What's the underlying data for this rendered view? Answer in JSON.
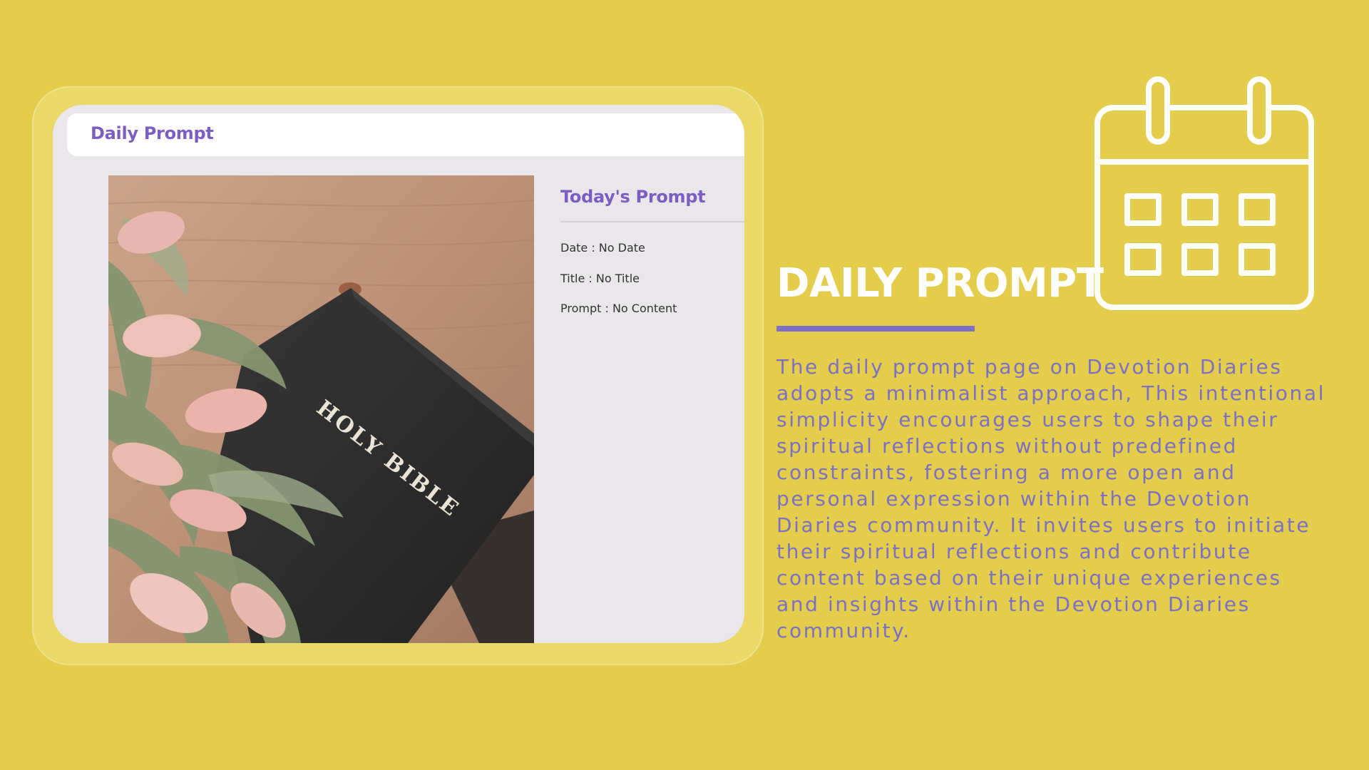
{
  "mockup": {
    "header_title": "Daily Prompt",
    "panel": {
      "title": "Today's Prompt",
      "date_line": "Date : No Date",
      "title_line": "Title : No Title",
      "prompt_line": "Prompt : No Content"
    },
    "photo": {
      "book_text": "HOLY BIBLE"
    }
  },
  "icons": {
    "calendar": "calendar-icon"
  },
  "right": {
    "title": "DAILY PROMPT",
    "body": "The daily prompt page on Devotion Diaries adopts a minimalist approach, This intentional simplicity encourages users to shape their spiritual reflections without predefined constraints, fostering a more open and personal expression within the Devotion Diaries community. It invites users to initiate their spiritual reflections and contribute content based on their unique experiences and insights within the Devotion Diaries community."
  },
  "colors": {
    "background": "#e4cd4b",
    "accent_purple": "#7b6fc6",
    "heading_purple": "#7a5ec2",
    "white": "#ffffff"
  }
}
